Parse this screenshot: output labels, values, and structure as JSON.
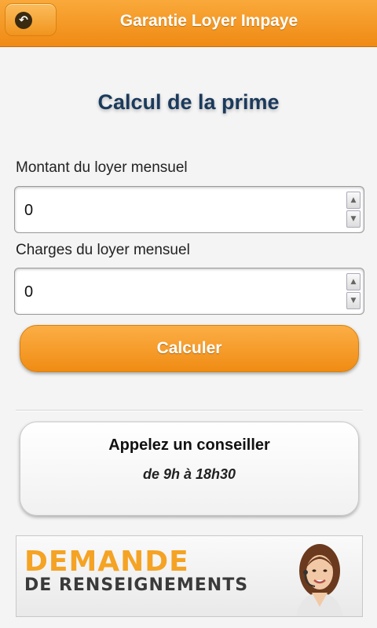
{
  "header": {
    "title": "Garantie Loyer Impaye",
    "back_icon": "back-arrow-icon"
  },
  "page": {
    "title": "Calcul de la prime"
  },
  "form": {
    "rent_label": "Montant du loyer mensuel",
    "rent_value": "0",
    "charges_label": "Charges du loyer mensuel",
    "charges_value": "0",
    "spin_up": "▲",
    "spin_down": "▼",
    "submit_label": "Calculer"
  },
  "contact": {
    "title": "Appelez un conseiller",
    "hours": "de 9h à 18h30"
  },
  "banner": {
    "line1": "DEMANDE",
    "line2": "DE RENSEIGNEMENTS"
  },
  "colors": {
    "accent": "#f39a22",
    "title": "#1b3a5c"
  }
}
